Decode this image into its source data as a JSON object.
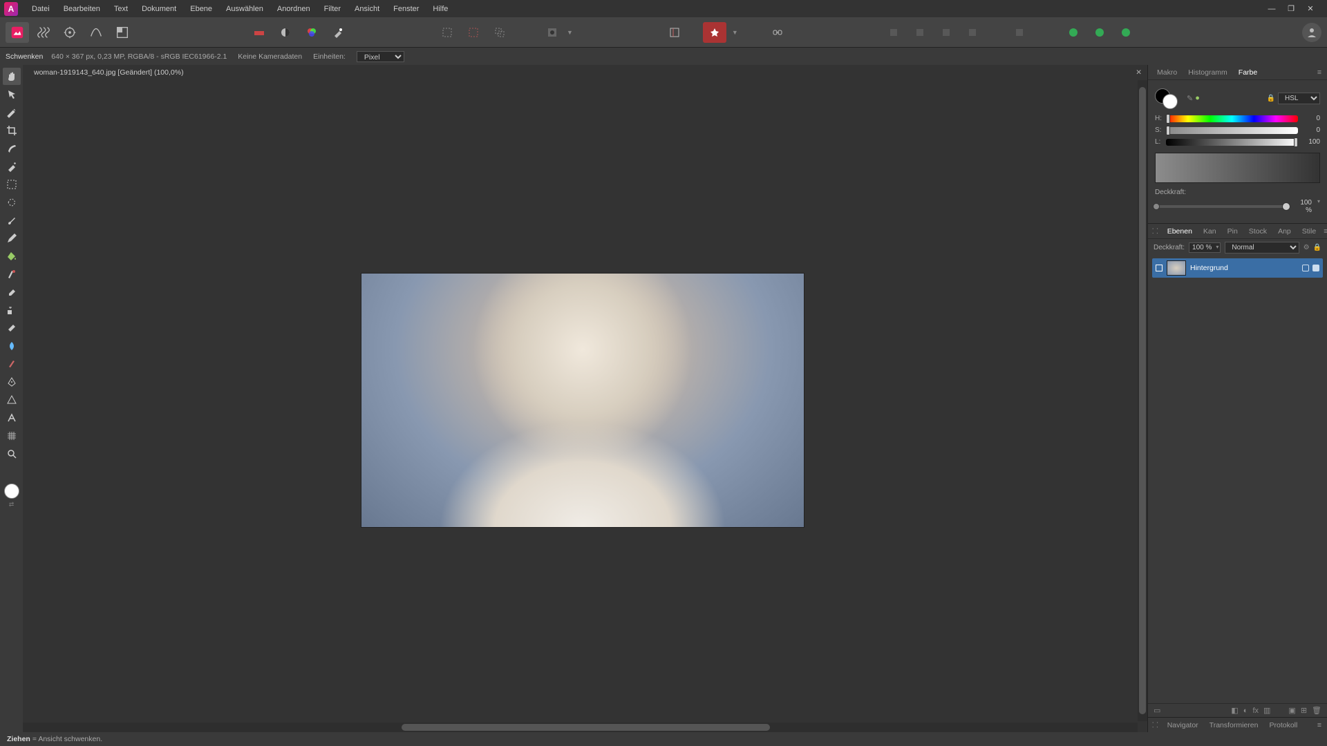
{
  "menubar": {
    "items": [
      "Datei",
      "Bearbeiten",
      "Text",
      "Dokument",
      "Ebene",
      "Auswählen",
      "Anordnen",
      "Filter",
      "Ansicht",
      "Fenster",
      "Hilfe"
    ]
  },
  "window": {
    "minimize": "—",
    "maximize": "❐",
    "close": "✕"
  },
  "toolbar": {
    "persona_icons": [
      "photo-persona",
      "liquify-persona",
      "develop-persona",
      "tonemap-persona",
      "export-persona"
    ],
    "scope_icons": [
      "autolevel-icon",
      "autocontrast-icon",
      "autocolor-icon",
      "autowhite-icon"
    ],
    "sel_icons": [
      "refine-icon",
      "deselect-icon",
      "invert-icon"
    ],
    "quick_mask": "quickmask-icon",
    "launch": "assistant-icon",
    "order_icons": [
      "back-icon",
      "backward-icon",
      "forward-icon",
      "front-icon"
    ],
    "align_icons": [
      "align-l",
      "align-c",
      "align-r"
    ],
    "snap_icons": [
      "snap-a",
      "snap-b",
      "snap-c"
    ]
  },
  "contextbar": {
    "tool_label": "Schwenken",
    "doc_info": "640 × 367 px, 0,23 MP, RGBA/8 - sRGB IEC61966-2.1",
    "camera": "Keine Kameradaten",
    "units_label": "Einheiten:",
    "units_value": "Pixel"
  },
  "document": {
    "tab_title": "woman-1919143_640.jpg [Geändert] (100,0%)"
  },
  "right_tabs_top": {
    "items": [
      "Makro",
      "Histogramm",
      "Farbe"
    ],
    "active": 2
  },
  "color_panel": {
    "mode": "HSL",
    "h": {
      "label": "H:",
      "value": "0",
      "pos": 0
    },
    "s": {
      "label": "S:",
      "value": "0",
      "pos": 0
    },
    "l": {
      "label": "L:",
      "value": "100",
      "pos": 100
    },
    "opacity_label": "Deckkraft:",
    "opacity_value": "100 %"
  },
  "layer_tabs": {
    "items": [
      "Ebenen",
      "Kan",
      "Pin",
      "Stock",
      "Anp",
      "Stile"
    ],
    "active": 0
  },
  "layers_panel": {
    "opacity_label": "Deckkraft:",
    "opacity_value": "100 %",
    "blend_mode": "Normal",
    "layer_name": "Hintergrund"
  },
  "bottom_tabs": {
    "items": [
      "Navigator",
      "Transformieren",
      "Protokoll"
    ]
  },
  "statusbar": {
    "bold": "Ziehen",
    "rest": " = Ansicht schwenken."
  },
  "left_tools": [
    "hand-tool",
    "move-tool",
    "color-picker-tool",
    "crop-tool",
    "selection-brush-tool",
    "flood-select-tool",
    "marquee-tool",
    "freehand-tool",
    "paint-brush-tool",
    "pixel-tool",
    "fill-tool",
    "gradient-tool",
    "erase-tool",
    "clone-tool",
    "dodge-tool",
    "pen-tool",
    "node-tool",
    "text-tool",
    "shape-tool",
    "zoom-tool"
  ]
}
